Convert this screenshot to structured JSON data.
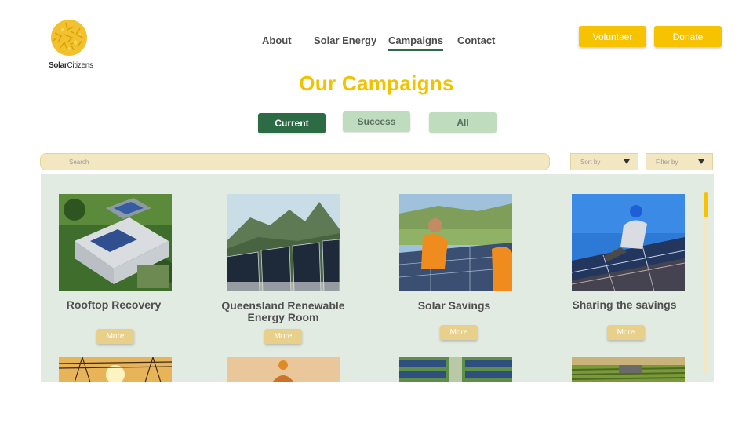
{
  "brand": {
    "logo_text_bold": "Solar",
    "logo_text_light": "Citizens"
  },
  "nav": {
    "about": "About",
    "solar_energy": "Solar Energy",
    "campaigns": "Campaigns",
    "contact": "Contact"
  },
  "actions": {
    "volunteer": "Volunteer",
    "donate": "Donate"
  },
  "page_title": "Our Campaigns",
  "filters": {
    "current": "Current",
    "success": "Success",
    "all": "All",
    "active": "Current"
  },
  "search": {
    "placeholder": "Search"
  },
  "sort_by": "Sort by",
  "filter_by": "Filter by",
  "cards": [
    {
      "title": "Rooftop Recovery",
      "more": "More"
    },
    {
      "title": "Queensland Renewable Energy Room",
      "more": "More"
    },
    {
      "title": "Solar Savings",
      "more": "More"
    },
    {
      "title": "Sharing the savings",
      "more": "More"
    }
  ],
  "colors": {
    "accent_yellow": "#f7c200",
    "brand_green": "#2d6b45",
    "panel_bg": "#e2ebe2",
    "tab_inactive": "#bfdcbf"
  }
}
